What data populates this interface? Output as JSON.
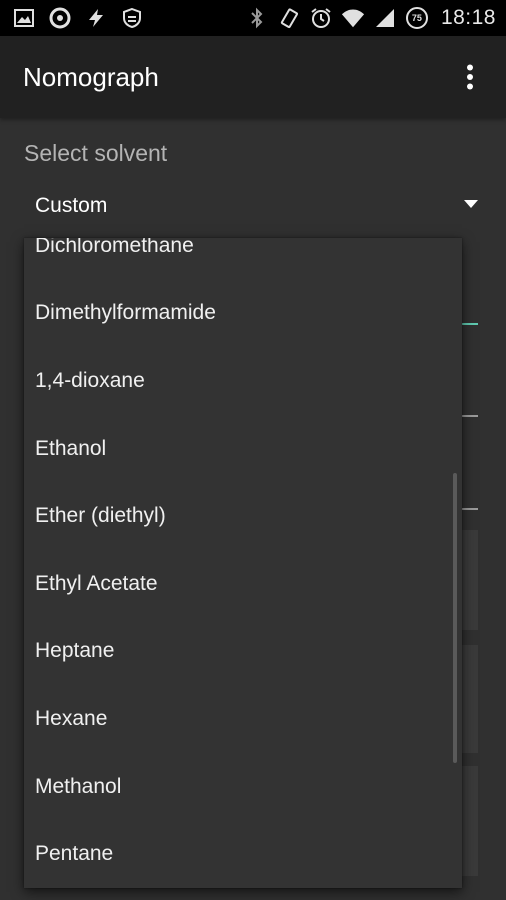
{
  "status_bar": {
    "time": "18:18",
    "battery_level": "75",
    "left_icons": [
      "image-icon",
      "circle-a-icon",
      "flash-icon",
      "shield-icon"
    ],
    "right_icons": [
      "bluetooth-icon",
      "vibrate-icon",
      "alarm-icon",
      "wifi-icon",
      "signal-icon",
      "battery-icon"
    ]
  },
  "app_bar": {
    "title": "Nomograph",
    "overflow_icon": "more-vert-icon"
  },
  "main": {
    "section_label": "Select solvent",
    "spinner": {
      "selected": "Custom",
      "arrow_icon": "dropdown-triangle-icon"
    },
    "dropdown": {
      "items": [
        "Dichloromethane",
        "Dimethylformamide",
        "1,4-dioxane",
        "Ethanol",
        "Ether (diethyl)",
        "Ethyl Acetate",
        "Heptane",
        "Hexane",
        "Methanol",
        "Pentane"
      ]
    }
  },
  "colors": {
    "status_bar_bg": "#000000",
    "app_bar_bg": "#212121",
    "background": "#303030",
    "dropdown_bg": "#333333",
    "accent": "#5fc9b0",
    "secondary_text": "#b4b4b4"
  }
}
